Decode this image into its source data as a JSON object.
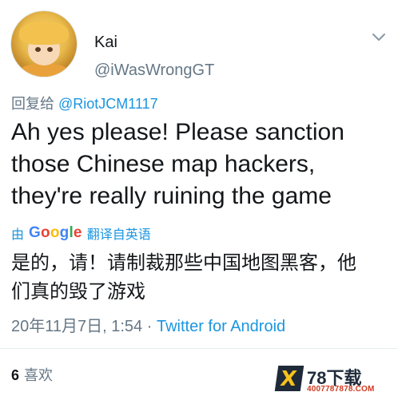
{
  "user": {
    "name": "Kai",
    "handle": "@iWasWrongGT",
    "avatar_icon": "anime-avatar"
  },
  "reply": {
    "prefix": "回复给 ",
    "mention": "@RiotJCM1117"
  },
  "tweet": {
    "text": "Ah yes please! Please sanction\nthose Chinese map hackers,\nthey're really ruining the game"
  },
  "translation_bar": {
    "by": "由",
    "provider": "Google",
    "label": "翻译自英语"
  },
  "translation": {
    "text": "是的，请！请制裁那些中国地图黑客，他\n们真的毁了游戏"
  },
  "meta": {
    "time": "20年11月7日, 1:54",
    "separator": "·",
    "client": "Twitter for Android"
  },
  "stats": {
    "likes_count": "6",
    "likes_label": "喜欢"
  },
  "watermark": {
    "title": "78下载",
    "url": "4007787878.COM",
    "logo_letter": "X"
  },
  "colors": {
    "link": "#1b95e0",
    "muted": "#657786",
    "text": "#14171a"
  }
}
